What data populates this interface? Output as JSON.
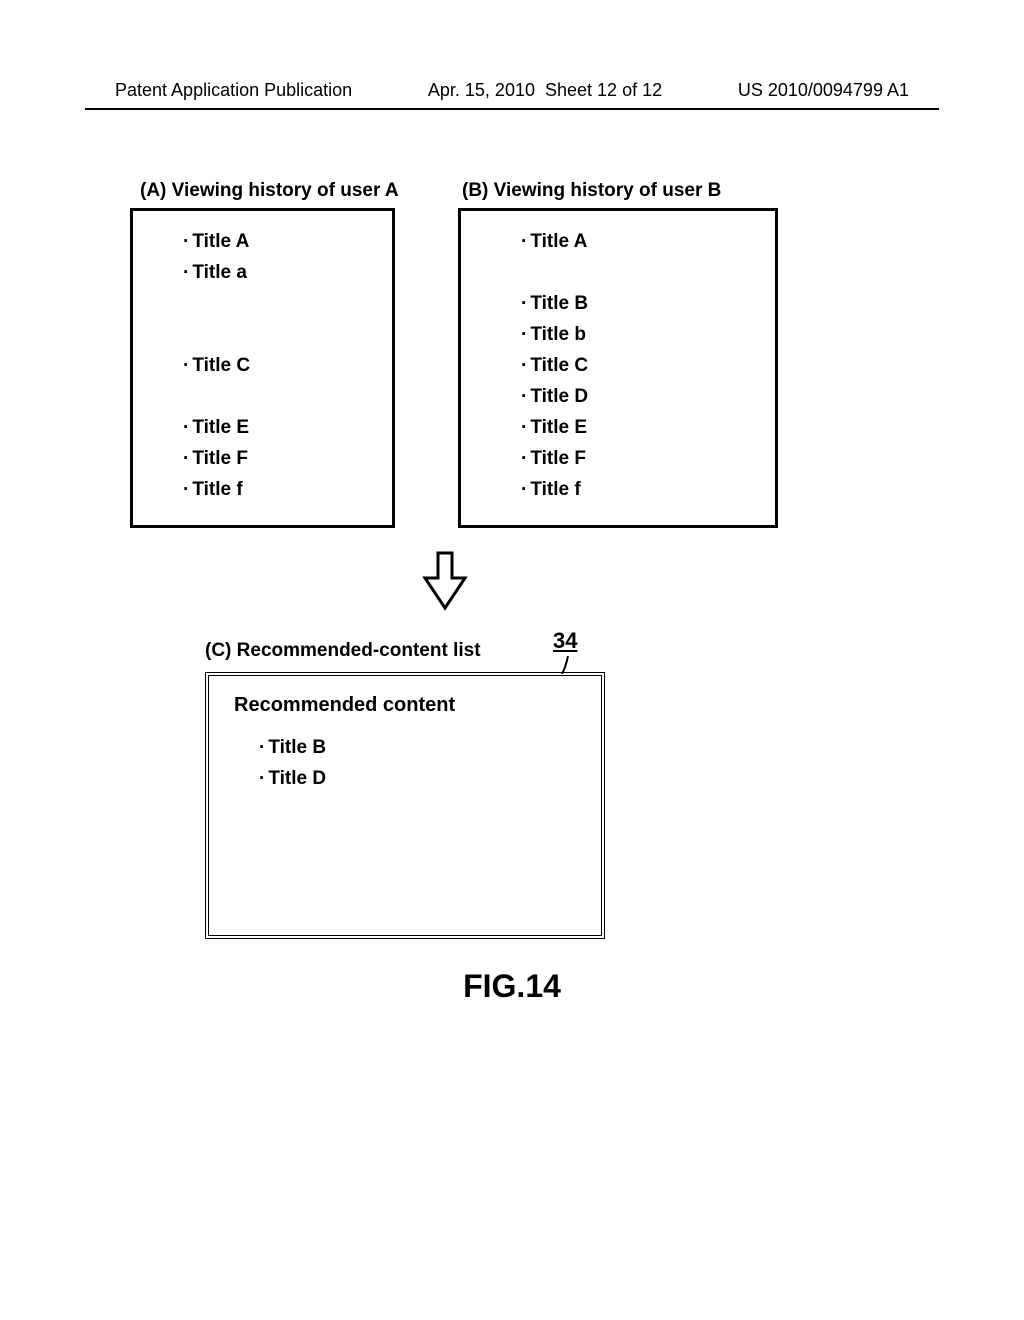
{
  "header": {
    "publication": "Patent Application Publication",
    "date": "Apr. 15, 2010",
    "sheet": "Sheet 12 of 12",
    "pubno": "US 2010/0094799 A1"
  },
  "section_a": {
    "label": "(A) Viewing history of user A",
    "items": [
      "Title A",
      "Title a",
      "",
      "",
      "Title C",
      "",
      "Title E",
      "Title F",
      "Title f"
    ]
  },
  "section_b": {
    "label": "(B) Viewing history of user B",
    "items": [
      "Title A",
      "",
      "Title B",
      "Title b",
      "Title C",
      "Title D",
      "Title E",
      "Title F",
      "Title f"
    ]
  },
  "section_c": {
    "label": "(C) Recommended-content list",
    "ref": "34",
    "title": "Recommended content",
    "items": [
      "Title B",
      "Title D"
    ]
  },
  "figure": "FIG.14"
}
